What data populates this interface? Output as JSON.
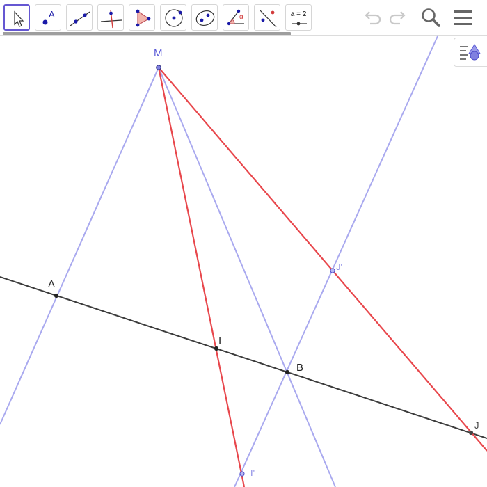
{
  "app": {
    "colors": {
      "accent": "#6557d2",
      "construction_line": "#a9a9ef",
      "red_line": "#e8474c",
      "black_line": "#3c3c3c",
      "point_blue": "#7f7fe0",
      "label_blue": "#5a5ad8"
    }
  },
  "toolbar": {
    "tools": [
      {
        "name": "move-tool",
        "icon": "cursor-arrow-icon",
        "active": true
      },
      {
        "name": "point-tool",
        "icon": "point-icon",
        "label": "A"
      },
      {
        "name": "line-tool",
        "icon": "line-through-points-icon"
      },
      {
        "name": "perpendicular-line-tool",
        "icon": "perpendicular-line-icon"
      },
      {
        "name": "polygon-tool",
        "icon": "polygon-icon"
      },
      {
        "name": "circle-center-point-tool",
        "icon": "circle-center-icon"
      },
      {
        "name": "conic-tool",
        "icon": "ellipse-icon"
      },
      {
        "name": "angle-tool",
        "icon": "angle-icon",
        "label": "α"
      },
      {
        "name": "reflect-tool",
        "icon": "reflect-about-line-icon"
      },
      {
        "name": "slider-tool",
        "icon": "slider-icon",
        "label": "a = 2"
      }
    ],
    "undo_icon": "undo-icon",
    "redo_icon": "redo-icon",
    "search_icon": "search-icon",
    "menu_icon": "hamburger-menu-icon",
    "style_bar_icon": "style-bar-toggle-icon"
  },
  "graphics": {
    "points": [
      {
        "label": "M",
        "kind": "free"
      },
      {
        "label": "A",
        "kind": "fixed"
      },
      {
        "label": "I",
        "kind": "fixed"
      },
      {
        "label": "B",
        "kind": "fixed"
      },
      {
        "label": "J",
        "kind": "fixed"
      },
      {
        "label": "J'",
        "kind": "free"
      },
      {
        "label": "I'",
        "kind": "free"
      }
    ]
  }
}
